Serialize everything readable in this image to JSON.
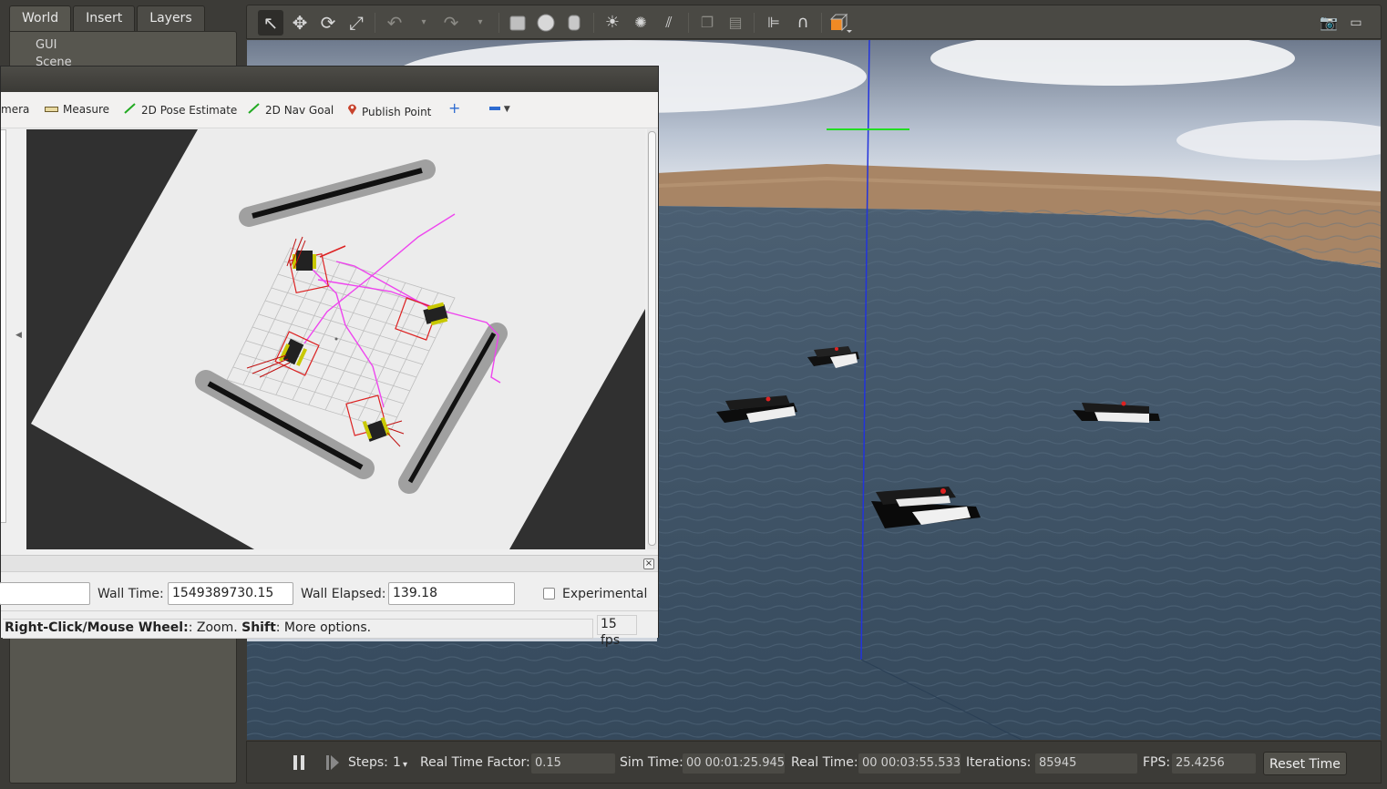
{
  "gazebo": {
    "left_tabs": [
      "World",
      "Insert",
      "Layers"
    ],
    "tree_items": [
      "GUI",
      "Scene"
    ],
    "toolbar_icons": [
      "select-mode-icon",
      "translate-mode-icon",
      "rotate-mode-icon",
      "scale-mode-icon",
      "undo-icon",
      "undo-history-icon",
      "redo-icon",
      "redo-history-icon",
      "box-shape-icon",
      "sphere-shape-icon",
      "cylinder-shape-icon",
      "point-light-icon",
      "spot-light-icon",
      "directional-light-icon",
      "copy-icon",
      "paste-icon",
      "align-icon",
      "snap-icon",
      "view-angle-icon",
      "screenshot-icon",
      "log-icon"
    ],
    "bottom": {
      "steps_label": "Steps:",
      "steps_value": "1",
      "rtf_label": "Real Time Factor:",
      "rtf_value": "0.15",
      "sim_time_label": "Sim Time:",
      "sim_time_value": "00 00:01:25.945",
      "real_time_label": "Real Time:",
      "real_time_value": "00 00:03:55.533",
      "iterations_label": "Iterations:",
      "iterations_value": "85945",
      "fps_label": "FPS:",
      "fps_value": "25.4256",
      "reset_label": "Reset Time"
    }
  },
  "rviz": {
    "tools": [
      {
        "label": "mera",
        "icon": "camera-icon"
      },
      {
        "label": "Measure",
        "icon": "ruler-icon"
      },
      {
        "label": "2D Pose Estimate",
        "icon": "green-arrow-icon"
      },
      {
        "label": "2D Nav Goal",
        "icon": "green-arrow-icon"
      },
      {
        "label": "Publish Point",
        "icon": "map-pin-icon"
      },
      {
        "label": "",
        "icon": "plus-icon"
      },
      {
        "label": "",
        "icon": "minus-icon"
      }
    ],
    "time": {
      "wall_time_label": "Wall Time:",
      "wall_time_value": "1549389730.15",
      "wall_elapsed_label": "Wall Elapsed:",
      "wall_elapsed_value": "139.18",
      "experimental_label": "Experimental",
      "experimental_checked": false
    },
    "status": {
      "bold1": "Right-Click/Mouse Wheel:",
      "text1": ": Zoom. ",
      "bold2": "Shift",
      "text2": ": More options.",
      "fps": "15 fps"
    }
  },
  "colors": {
    "water": "#3d5468",
    "sand": "#a88565",
    "path": "#ee44ee",
    "robot_footprint": "#dd2222",
    "wall_inflation": "#a0a0a0"
  }
}
